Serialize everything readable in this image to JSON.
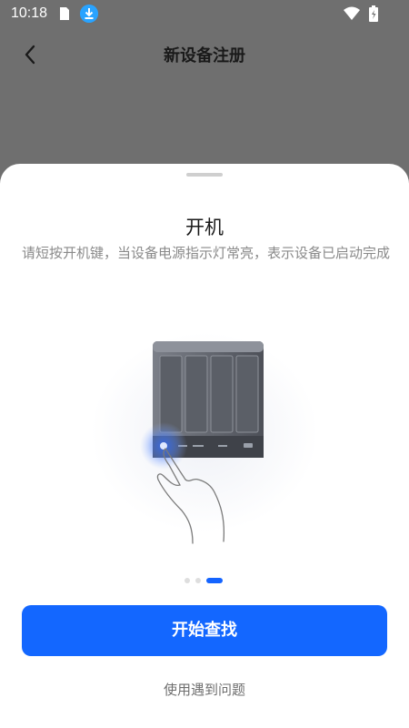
{
  "status_bar": {
    "time": "10:18",
    "icons": [
      "sim-card-icon",
      "download-icon",
      "wifi-icon",
      "battery-icon"
    ]
  },
  "header": {
    "title": "新设备注册",
    "back_icon": "chevron-left-icon"
  },
  "sheet": {
    "step_title": "开机",
    "step_description": "请短按开机键，当设备电源指示灯常亮，表示设备已启动完成",
    "illustration": "nas-device-power-button-press",
    "pager": {
      "total": 3,
      "current": 3
    },
    "primary_button_label": "开始查找",
    "help_link_label": "使用遇到问题"
  },
  "colors": {
    "accent": "#1367ff",
    "backdrop": "#6f6f6f",
    "sheet": "#ffffff",
    "secondary_text": "#8a8a8a"
  }
}
